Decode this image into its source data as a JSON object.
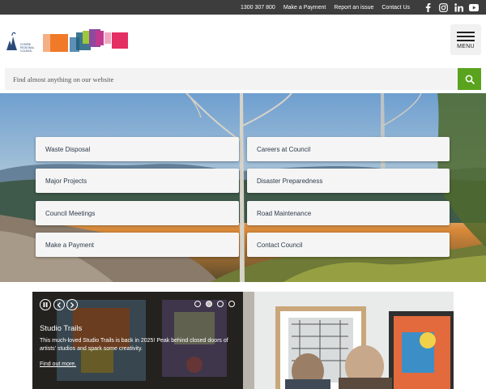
{
  "topbar": {
    "links": [
      "1300 307 800",
      "Make a Payment",
      "Report an issue",
      "Contact Us"
    ],
    "social": [
      "facebook-icon",
      "instagram-icon",
      "linkedin-icon",
      "youtube-icon"
    ]
  },
  "header": {
    "logo_text": "GYMPIE REGIONAL COUNCIL",
    "menu_label": "MENU"
  },
  "search": {
    "placeholder": "Find almost anything on our website",
    "button_icon": "search-icon",
    "accent": "#5aa31e"
  },
  "quick_links": [
    "Waste Disposal",
    "Careers at Council",
    "Major Projects",
    "Disaster Preparedness",
    "Council Meetings",
    "Road Maintenance",
    "Make a Payment",
    "Contact Council"
  ],
  "slideshow": {
    "title": "Studio Trails",
    "text": "This much-loved Studio Trails is back in 2025! Peak behind closed doors of artists' studios and spark some creativity.",
    "link": "Find out more.",
    "controls": [
      "pause-icon",
      "previous-icon",
      "next-icon"
    ],
    "slide_count": 4,
    "active_slide": 2
  }
}
